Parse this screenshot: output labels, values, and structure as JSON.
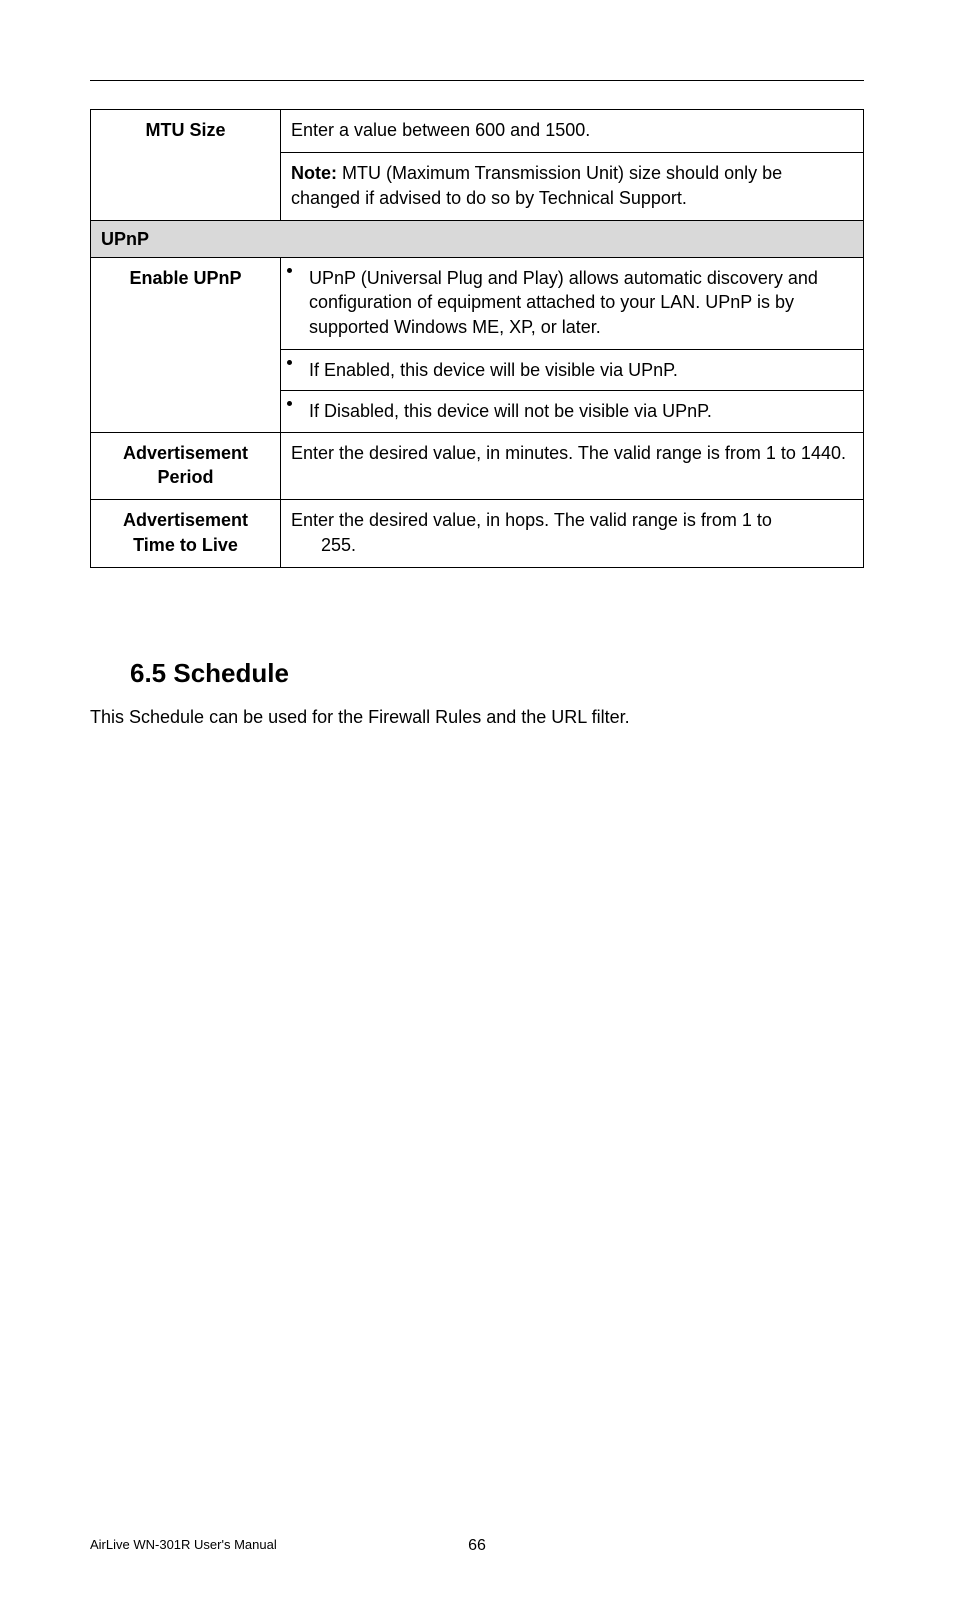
{
  "table": {
    "rows": {
      "mtu": {
        "label": "MTU Size",
        "line1": "Enter a value between 600 and 1500.",
        "note_label": "Note:",
        "note_text": " MTU (Maximum Transmission Unit) size should only be changed if advised to do so by Technical Support."
      },
      "upnp_section": "UPnP",
      "enable_upnp": {
        "label": "Enable UPnP",
        "b1": "UPnP (Universal Plug and Play) allows automatic discovery and configuration of equipment attached to your LAN. UPnP is by supported Windows ME, XP, or later.",
        "b2": "If Enabled, this device will be visible via UPnP.",
        "b3": "If Disabled, this device will not be visible via UPnP."
      },
      "adv_period": {
        "label": "Advertisement Period",
        "text": "Enter the desired value, in minutes. The valid range is from 1 to 1440."
      },
      "adv_ttl": {
        "label": "Advertisement Time to Live",
        "text_a": "Enter the desired value, in hops. The valid range is from 1 to",
        "text_b": "255."
      }
    }
  },
  "heading": "6.5  Schedule",
  "body": "This Schedule can be used for the Firewall Rules and the URL filter.",
  "footer": {
    "left": "AirLive WN-301R User's Manual",
    "page": "66"
  }
}
